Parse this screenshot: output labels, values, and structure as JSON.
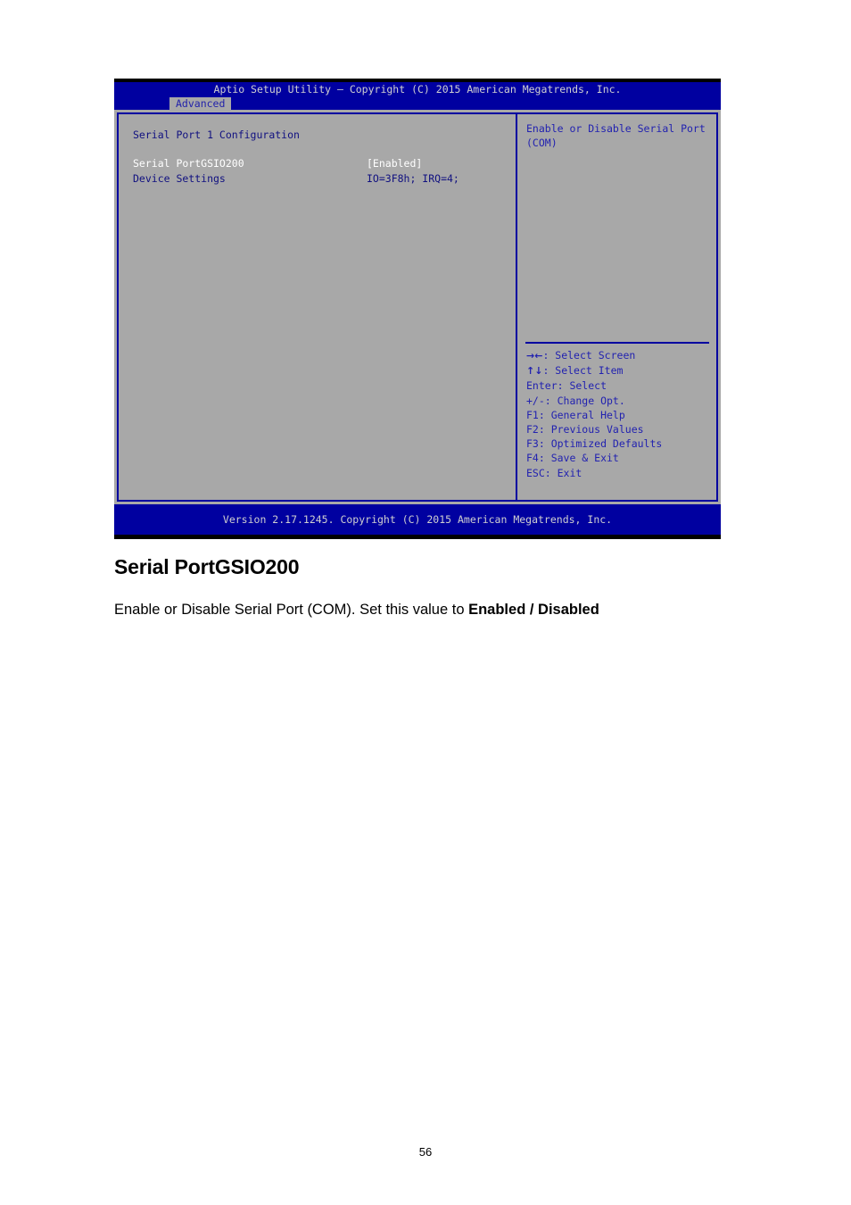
{
  "bios": {
    "title": "Aptio Setup Utility – Copyright (C) 2015 American Megatrends, Inc.",
    "active_tab": "Advanced",
    "section_title": "Serial Port 1 Configuration",
    "settings": [
      {
        "label": "Serial PortGSIO200",
        "value": "[Enabled]",
        "selected": true
      },
      {
        "label": "Device Settings",
        "value": "IO=3F8h; IRQ=4;",
        "selected": false
      }
    ],
    "help_text": "Enable or Disable Serial Port (COM)",
    "keys": [
      {
        "glyph": "→←",
        "text": ": Select Screen"
      },
      {
        "glyph": "↑↓",
        "text": ": Select Item"
      },
      {
        "glyph": "",
        "text": "Enter: Select"
      },
      {
        "glyph": "",
        "text": "+/-: Change Opt."
      },
      {
        "glyph": "",
        "text": "F1: General Help"
      },
      {
        "glyph": "",
        "text": "F2: Previous Values"
      },
      {
        "glyph": "",
        "text": "F3: Optimized Defaults"
      },
      {
        "glyph": "",
        "text": "F4: Save & Exit"
      },
      {
        "glyph": "",
        "text": "ESC: Exit"
      }
    ],
    "version": "Version 2.17.1245. Copyright (C) 2015 American Megatrends, Inc.",
    "colors": {
      "blue_bg": "#0000a0",
      "gray_panel": "#a8a8a8",
      "text_blue": "#2222b0",
      "text_selected": "#ffffff",
      "title_text": "#d0d0d0"
    }
  },
  "document": {
    "heading": "Serial PortGSIO200",
    "paragraph_prefix": "Enable or Disable Serial Port (COM). Set this value to ",
    "paragraph_bold": "Enabled / Disabled",
    "page_number": "56"
  }
}
